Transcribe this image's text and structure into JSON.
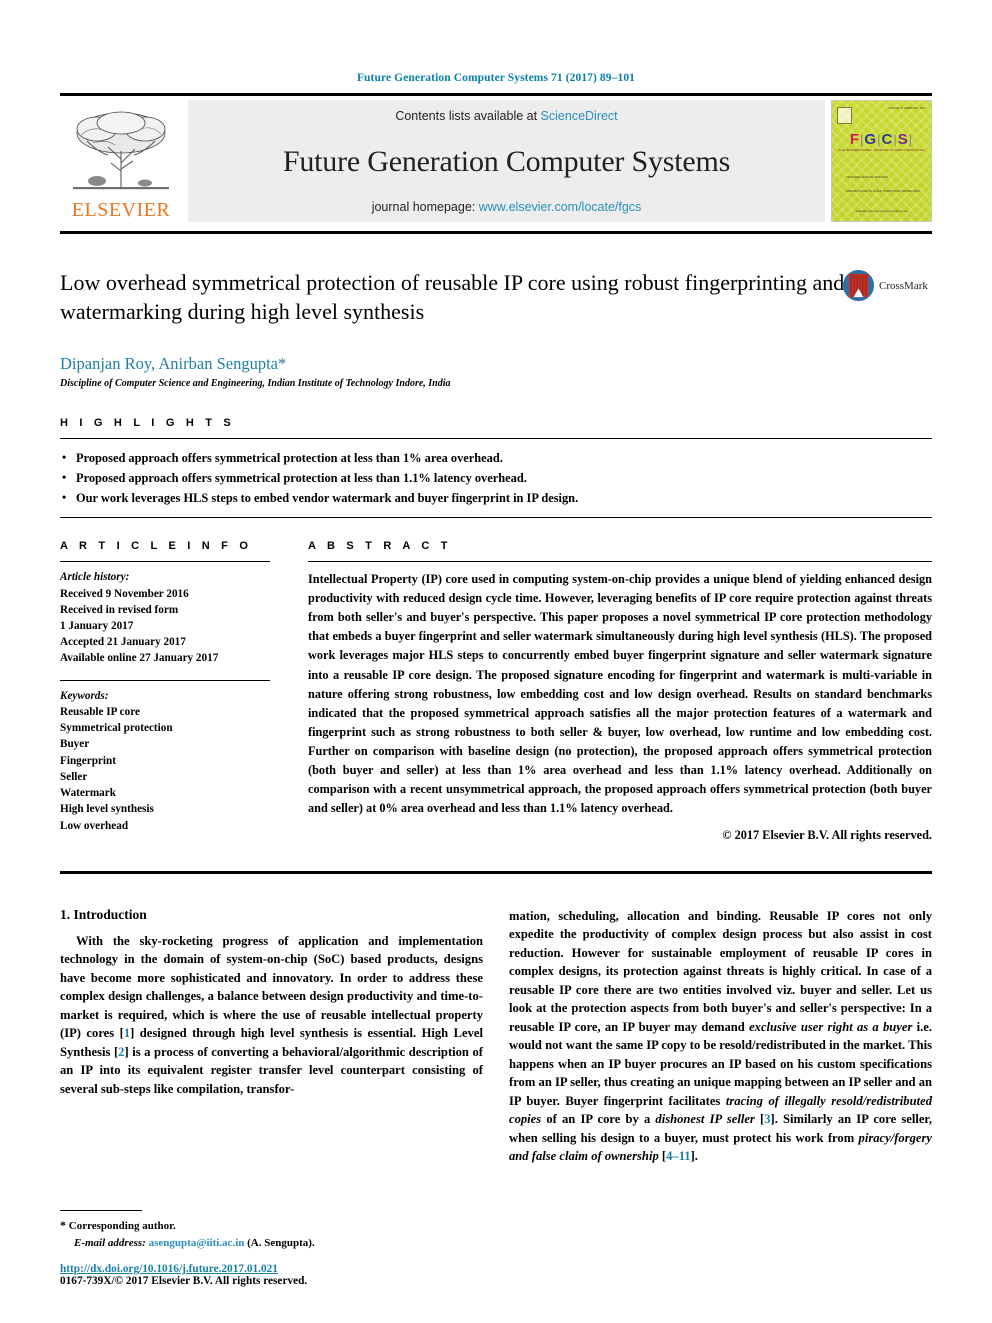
{
  "running_head": "Future Generation Computer Systems 71 (2017) 89–101",
  "masthead": {
    "publisher_logo_label": "ELSEVIER",
    "contents_prefix": "Contents lists available at ",
    "contents_link": "ScienceDirect",
    "journal_title": "Future Generation Computer Systems",
    "homepage_prefix": "journal homepage: ",
    "homepage_link": "www.elsevier.com/locate/fgcs",
    "cover": {
      "acronym_letters": [
        "F",
        "G",
        "C",
        "S"
      ],
      "tagline": "THE INTERNATIONAL JOURNAL OF GRID COMPUTING",
      "block_a": "FEATURED ARTICLE\nGRID 2016",
      "block_b": "SPECIAL ISSUE ON\nCLOUD COMPUTING\nAND BIG DATA",
      "bottom_text": "Available online at\nwww.sciencedirect.com",
      "badge_text_left": "ISSN 0167-739X",
      "badge_text_right": "VOLUME 71  FEBRUARY 2017"
    }
  },
  "title": "Low overhead symmetrical protection of reusable IP core using robust fingerprinting and watermarking during high level synthesis",
  "crossmark_label": "CrossMark",
  "authors": "Dipanjan Roy, Anirban Sengupta",
  "author_star": "*",
  "affiliation": "Discipline of Computer Science and Engineering, Indian Institute of Technology Indore, India",
  "highlights": {
    "heading": "H I G H L I G H T S",
    "items": [
      "Proposed approach offers symmetrical protection at less than 1% area overhead.",
      "Proposed approach offers symmetrical protection at less than 1.1% latency overhead.",
      "Our work leverages HLS steps to embed vendor watermark and buyer fingerprint in IP design."
    ]
  },
  "article_info": {
    "heading": "A R T I C L E    I N F O",
    "history_label": "Article history:",
    "history": [
      "Received 9 November 2016",
      "Received in revised form",
      "1 January 2017",
      "Accepted 21 January 2017",
      "Available online 27 January 2017"
    ],
    "keywords_label": "Keywords:",
    "keywords": [
      "Reusable IP core",
      "Symmetrical protection",
      "Buyer",
      "Fingerprint",
      "Seller",
      "Watermark",
      "High level synthesis",
      "Low overhead"
    ]
  },
  "abstract": {
    "heading": "A B S T R A C T",
    "text": "Intellectual Property (IP) core used in computing system-on-chip provides a unique blend of yielding enhanced design productivity with reduced design cycle time. However, leveraging benefits of IP core require protection against threats from both seller's and buyer's perspective. This paper proposes a novel symmetrical IP core protection methodology that embeds a buyer fingerprint and seller watermark simultaneously during high level synthesis (HLS). The proposed work leverages major HLS steps to concurrently embed buyer fingerprint signature and seller watermark signature into a reusable IP core design. The proposed signature encoding for fingerprint and watermark is multi-variable in nature offering strong robustness, low embedding cost and low design overhead. Results on standard benchmarks indicated that the proposed symmetrical approach satisfies all the major protection features of a watermark and fingerprint such as strong robustness to both seller & buyer, low overhead, low runtime and low embedding cost. Further on comparison with baseline design (no protection), the proposed approach offers symmetrical protection (both buyer and seller) at less than 1% area overhead and less than 1.1% latency overhead. Additionally on comparison with a recent unsymmetrical approach, the proposed approach offers symmetrical protection (both buyer and seller) at 0% area overhead and less than 1.1% latency overhead.",
    "copyright": "© 2017 Elsevier B.V. All rights reserved."
  },
  "body": {
    "section_number_title": "1. Introduction",
    "left_paragraph_parts": {
      "p1a": "With the sky-rocketing progress of application and implementation technology in the domain of system-on-chip (SoC) based products, designs have become more sophisticated and innovatory. In order to address these complex design challenges, a balance between design productivity and time-to-market is required, which is where the use of reusable intellectual property (IP) cores [",
      "ref1": "1",
      "p1b": "] designed through high level synthesis is essential. High Level Synthesis [",
      "ref2": "2",
      "p1c": "] is a process of converting a behavioral/algorithmic description of an IP into its equivalent register transfer level counterpart consisting of several sub-steps like compilation, transfor-"
    },
    "right_paragraph_parts": {
      "p2a": "mation, scheduling, allocation and binding.  Reusable IP cores not only expedite the productivity of complex design process but also assist in cost reduction. However for sustainable employment of reusable IP cores in complex designs, its protection against threats is highly critical. In case of a reusable IP core there are two entities involved viz. buyer and seller. Let us look at the protection aspects from both buyer's and seller's perspective: In a reusable IP core, an IP buyer may demand ",
      "em1": "exclusive user right as a buyer",
      "p2b": " i.e. would not want the same IP copy to be resold/redistributed in the market. This happens when an IP buyer procures an IP based on his custom specifications from an IP seller, thus creating an unique mapping between an IP seller and an IP buyer. Buyer fingerprint facilitates ",
      "em2": "tracing of illegally resold/redistributed copies",
      "p2c": " of an IP core by a ",
      "em3": "dishonest IP seller",
      "p2d": " [",
      "ref3": "3",
      "p2e": "]. Similarly an IP core seller, when selling his design to a buyer, must protect his work from ",
      "em4": "piracy/forgery and false claim of ownership",
      "p2f": " [",
      "ref4": "4–11",
      "p2g": "]."
    }
  },
  "footnote": {
    "star": "*",
    "corresponding": "Corresponding author.",
    "email_label": "E-mail address:",
    "email": "asengupta@iiti.ac.in",
    "email_suffix": "(A. Sengupta).",
    "doi": "http://dx.doi.org/10.1016/j.future.2017.01.021",
    "issn_line": "0167-739X/© 2017 Elsevier B.V. All rights reserved."
  },
  "colors": {
    "link": "#2a8fbd",
    "author": "#1f7fa5",
    "running_head": "#0b7fab",
    "elsevier_orange": "#E87722",
    "reference": "#1a7fa8",
    "cover_bg": "#cddc39"
  }
}
